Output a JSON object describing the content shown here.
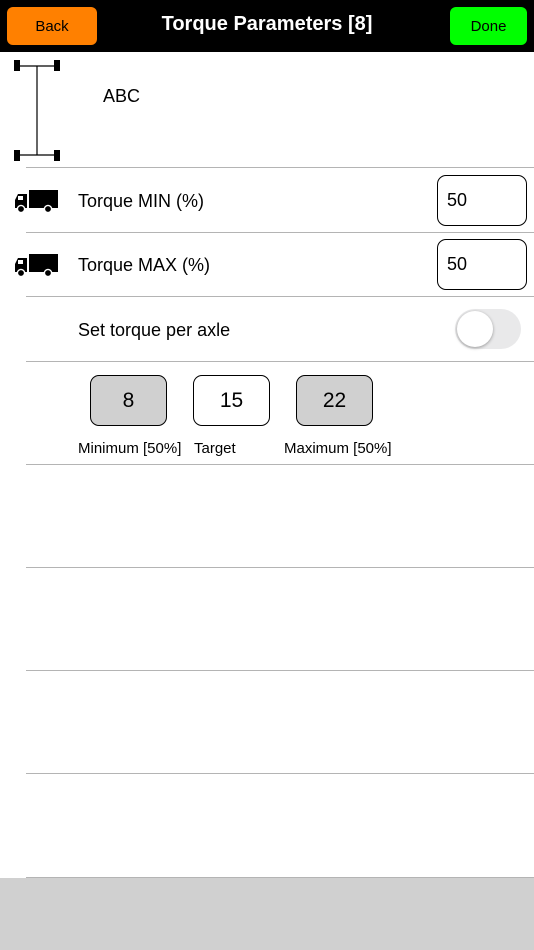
{
  "header": {
    "back_label": "Back",
    "title": "Torque Parameters [8]",
    "done_label": "Done",
    "back_color": "#ff8000",
    "done_color": "#00ff00"
  },
  "vehicle": {
    "name": "ABC",
    "icon": "axle-diagram-icon"
  },
  "torque_min": {
    "label": "Torque MIN (%)",
    "value": "50",
    "icon": "truck-icon"
  },
  "torque_max": {
    "label": "Torque MAX (%)",
    "value": "50",
    "icon": "truck-icon"
  },
  "per_axle": {
    "label": "Set torque per axle",
    "enabled": false
  },
  "values": {
    "minimum": "8",
    "target": "15",
    "maximum": "22",
    "minimum_label": "Minimum [50%]",
    "target_label": "Target",
    "maximum_label": "Maximum [50%]"
  }
}
